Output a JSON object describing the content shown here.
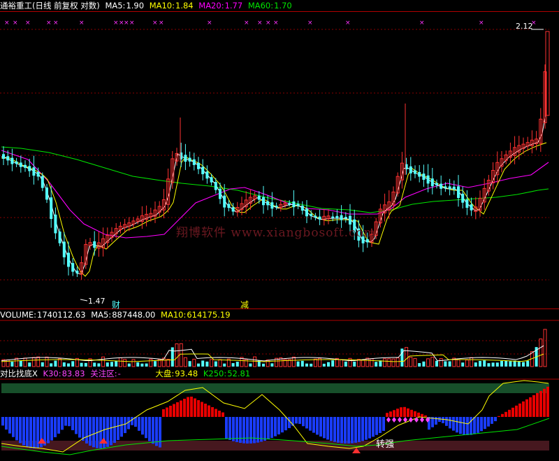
{
  "price_panel": {
    "stock_name": "通裕重工",
    "period_text": "(日线 前复权 对数)",
    "ma5_label": "MA5:",
    "ma5_value": "1.90",
    "ma10_label": "MA10:",
    "ma10_value": "1.84",
    "ma20_label": "MA20:",
    "ma20_value": "1.77",
    "ma60_label": "MA60:",
    "ma60_value": "1.70",
    "high_marker": "2.12",
    "low_marker": "1.47",
    "marker_cai": "财",
    "marker_jian": "减",
    "watermark": "翔博软件 www.xiangbosoft.com"
  },
  "volume_panel": {
    "volume_label": "VOLUME:",
    "volume_value": "1740112.63",
    "ma5_label": "MA5:",
    "ma5_value": "887448.00",
    "ma10_label": "MA10:",
    "ma10_value": "614175.19"
  },
  "indicator_panel": {
    "name": "对比找底X",
    "k30_label": "K30:",
    "k30_value": "83.83",
    "focus_label": "关注区:",
    "focus_value": "-",
    "market_label": "大盘:",
    "market_value": "93.48",
    "k250_label": "K250:",
    "k250_value": "52.81",
    "signal_text": "转强"
  },
  "colors": {
    "background": "#000000",
    "up_candle": "#ff3232",
    "down_candle": "#54ffff",
    "ma5": "#ffffff",
    "ma10": "#ffff00",
    "ma20": "#ff00ff",
    "ma60": "#00e600",
    "grid": "#8a0000"
  }
}
